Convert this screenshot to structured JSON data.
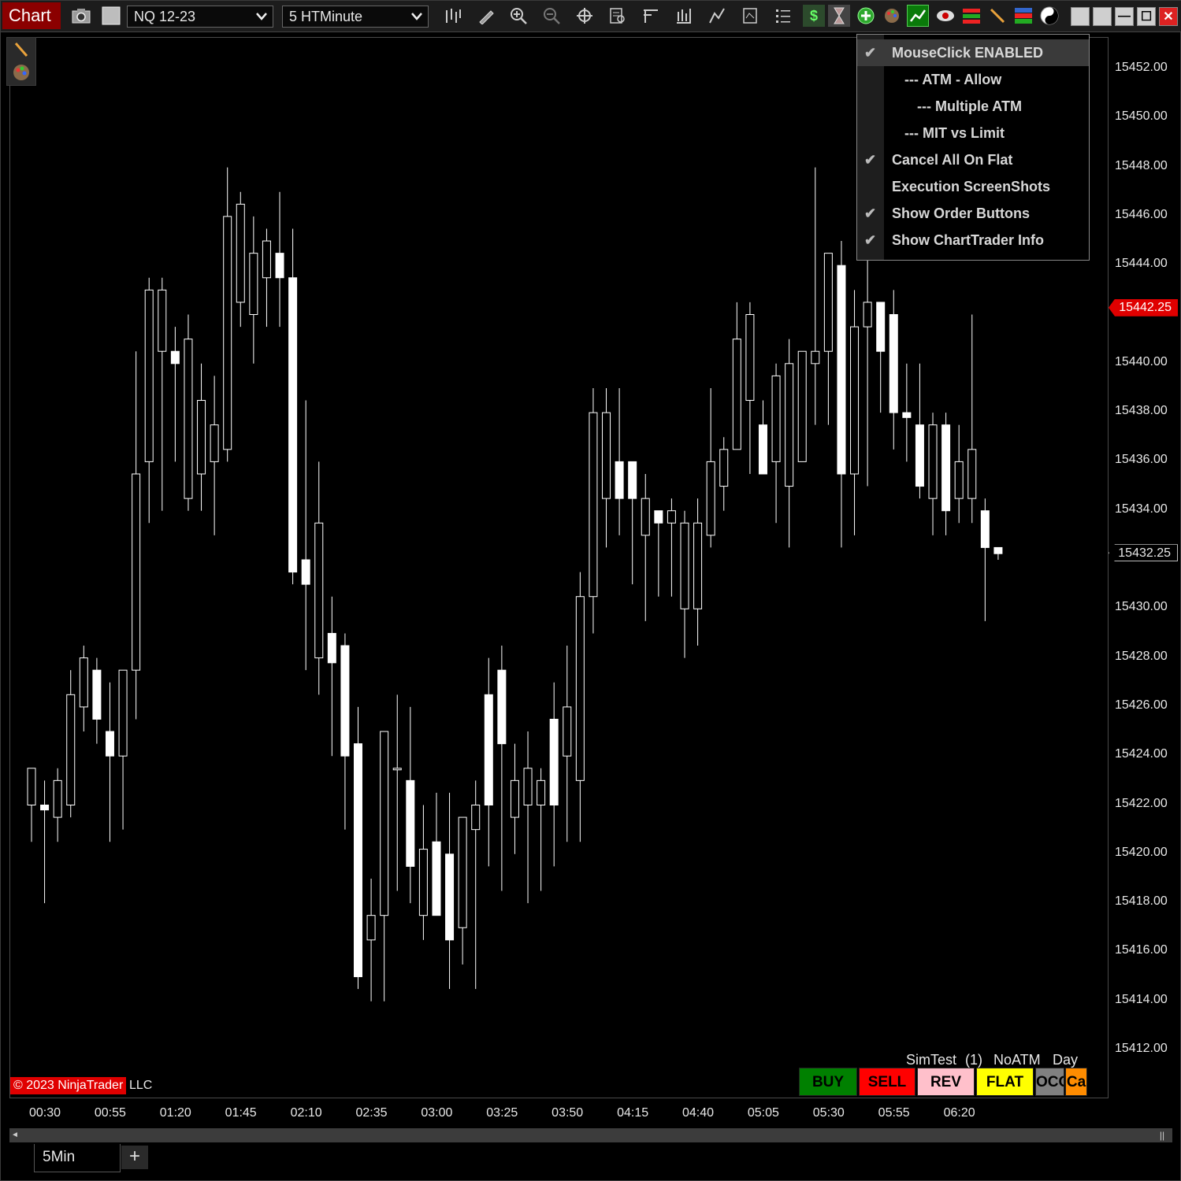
{
  "toolbar": {
    "title": "Chart",
    "instrument": "NQ 12-23",
    "interval": "5 HTMinute",
    "icons": [
      "camera-icon",
      "properties-icon",
      "bar-type-icon",
      "draw-icon",
      "zoom-in-icon",
      "zoom-out-icon",
      "crosshair-icon",
      "data-box-icon",
      "indicators-icon",
      "strategies-icon",
      "drawing-tools-icon",
      "templates-icon",
      "instrument-list-icon",
      "dollar-icon",
      "hourglass-icon",
      "add-icon",
      "palette-icon",
      "green-chart-icon",
      "eye-icon",
      "bars-color-icon",
      "pencil-icon",
      "flag-icon",
      "yin-yang-icon"
    ],
    "window_buttons": {
      "restore": "",
      "restore2": "",
      "minimize": "—",
      "maximize": "☐",
      "close": "✕"
    }
  },
  "menu": {
    "items": [
      {
        "label": "MouseClick ENABLED",
        "checked": true,
        "indent": 0
      },
      {
        "label": "--- ATM - Allow",
        "checked": false,
        "indent": 1
      },
      {
        "label": "--- Multiple ATM",
        "checked": false,
        "indent": 2
      },
      {
        "label": "--- MIT vs Limit",
        "checked": false,
        "indent": 1
      },
      {
        "label": "Cancel All On Flat",
        "checked": true,
        "indent": 0
      },
      {
        "label": "Execution ScreenShots",
        "checked": false,
        "indent": 0
      },
      {
        "label": "Show Order Buttons",
        "checked": true,
        "indent": 0
      },
      {
        "label": "Show ChartTrader Info",
        "checked": true,
        "indent": 0
      }
    ],
    "check_glyph": "✔"
  },
  "y_axis": {
    "ticks": [
      "15452.00",
      "15450.00",
      "15448.00",
      "15446.00",
      "15444.00",
      "15440.00",
      "15438.00",
      "15436.00",
      "15434.00",
      "15430.00",
      "15428.00",
      "15426.00",
      "15424.00",
      "15422.00",
      "15420.00",
      "15418.00",
      "15416.00",
      "15414.00",
      "15412.00"
    ],
    "last_price": "15442.25",
    "current_price": "15432.25"
  },
  "x_axis": {
    "ticks": [
      "00:30",
      "00:55",
      "01:20",
      "01:45",
      "02:10",
      "02:35",
      "03:00",
      "03:25",
      "03:50",
      "04:15",
      "04:40",
      "05:05",
      "05:30",
      "05:55",
      "06:20"
    ]
  },
  "copyright": {
    "text": "© 2023 NinjaTrader",
    "suffix": "LLC"
  },
  "trader_info": {
    "account": "SimTest",
    "qty": "(1)",
    "atm": "NoATM",
    "tif": "Day"
  },
  "order_buttons": [
    {
      "label": "BUY",
      "color": "#008000",
      "text": "#000000"
    },
    {
      "label": "SELL",
      "color": "#ff0000",
      "text": "#000000"
    },
    {
      "label": "REV",
      "color": "#ffc0cb",
      "text": "#000000"
    },
    {
      "label": "FLAT",
      "color": "#ffff00",
      "text": "#000000"
    },
    {
      "label": "OCO",
      "color": "#808080",
      "text": "#000000"
    },
    {
      "label": "Ca",
      "color": "#ff8c00",
      "text": "#000000"
    }
  ],
  "tabs": {
    "active": "5Min",
    "add": "+"
  },
  "scrollbar": {
    "left_glyph": "◄",
    "right_glyph": "||"
  },
  "colors": {
    "background": "#000000",
    "candle": "#ffffff",
    "last_price": "#e00000",
    "title_bg": "#8b0000"
  },
  "chart_data": {
    "type": "candlestick",
    "instrument": "NQ 12-23",
    "interval": "5 HTMinute",
    "ylim": [
      15410.5,
      15453.5
    ],
    "candles": [
      {
        "o": 15422.0,
        "h": 15423.5,
        "l": 15420.5,
        "c": 15423.5
      },
      {
        "o": 15422.0,
        "h": 15423.0,
        "l": 15418.0,
        "c": 15421.8
      },
      {
        "o": 15421.5,
        "h": 15423.5,
        "l": 15420.5,
        "c": 15423.0
      },
      {
        "o": 15422.0,
        "h": 15427.5,
        "l": 15421.5,
        "c": 15426.5
      },
      {
        "o": 15426.0,
        "h": 15428.5,
        "l": 15425.0,
        "c": 15428.0
      },
      {
        "o": 15427.5,
        "h": 15428.0,
        "l": 15424.5,
        "c": 15425.5
      },
      {
        "o": 15425.0,
        "h": 15427.0,
        "l": 15420.5,
        "c": 15424.0
      },
      {
        "o": 15424.0,
        "h": 15427.5,
        "l": 15421.0,
        "c": 15427.5
      },
      {
        "o": 15427.5,
        "h": 15440.5,
        "l": 15425.5,
        "c": 15435.5
      },
      {
        "o": 15436.0,
        "h": 15443.5,
        "l": 15433.5,
        "c": 15443.0
      },
      {
        "o": 15440.5,
        "h": 15443.5,
        "l": 15434.0,
        "c": 15443.0
      },
      {
        "o": 15440.5,
        "h": 15441.5,
        "l": 15436.0,
        "c": 15440.0
      },
      {
        "o": 15434.5,
        "h": 15442.0,
        "l": 15434.0,
        "c": 15441.0
      },
      {
        "o": 15435.5,
        "h": 15440.0,
        "l": 15434.0,
        "c": 15438.5
      },
      {
        "o": 15436.0,
        "h": 15439.5,
        "l": 15433.0,
        "c": 15437.5
      },
      {
        "o": 15436.5,
        "h": 15448.0,
        "l": 15436.0,
        "c": 15446.0
      },
      {
        "o": 15442.5,
        "h": 15447.0,
        "l": 15441.5,
        "c": 15446.5
      },
      {
        "o": 15442.0,
        "h": 15446.0,
        "l": 15440.0,
        "c": 15444.5
      },
      {
        "o": 15443.5,
        "h": 15445.5,
        "l": 15441.5,
        "c": 15445.0
      },
      {
        "o": 15444.5,
        "h": 15447.0,
        "l": 15441.5,
        "c": 15443.5
      },
      {
        "o": 15443.5,
        "h": 15445.5,
        "l": 15431.0,
        "c": 15431.5
      },
      {
        "o": 15432.0,
        "h": 15438.5,
        "l": 15427.5,
        "c": 15431.0
      },
      {
        "o": 15428.0,
        "h": 15436.0,
        "l": 15426.5,
        "c": 15433.5
      },
      {
        "o": 15429.0,
        "h": 15430.5,
        "l": 15424.0,
        "c": 15427.8
      },
      {
        "o": 15428.5,
        "h": 15429.0,
        "l": 15421.0,
        "c": 15424.0
      },
      {
        "o": 15424.5,
        "h": 15426.0,
        "l": 15414.5,
        "c": 15415.0
      },
      {
        "o": 15416.5,
        "h": 15419.0,
        "l": 15414.0,
        "c": 15417.5
      },
      {
        "o": 15417.5,
        "h": 15424.5,
        "l": 15414.0,
        "c": 15425.0
      },
      {
        "o": 15423.5,
        "h": 15426.5,
        "l": 15418.5,
        "c": 15423.5
      },
      {
        "o": 15423.0,
        "h": 15426.0,
        "l": 15418.0,
        "c": 15419.5
      },
      {
        "o": 15417.5,
        "h": 15422.0,
        "l": 15416.5,
        "c": 15420.2
      },
      {
        "o": 15420.5,
        "h": 15422.5,
        "l": 15417.5,
        "c": 15417.5
      },
      {
        "o": 15420.0,
        "h": 15422.5,
        "l": 15414.5,
        "c": 15416.5
      },
      {
        "o": 15417.0,
        "h": 15421.0,
        "l": 15415.5,
        "c": 15421.5
      },
      {
        "o": 15421.0,
        "h": 15423.0,
        "l": 15414.5,
        "c": 15422.0
      },
      {
        "o": 15426.5,
        "h": 15428.0,
        "l": 15419.5,
        "c": 15422.0
      },
      {
        "o": 15427.5,
        "h": 15428.5,
        "l": 15418.5,
        "c": 15424.5
      },
      {
        "o": 15421.5,
        "h": 15424.5,
        "l": 15420.0,
        "c": 15423.0
      },
      {
        "o": 15422.0,
        "h": 15425.0,
        "l": 15418.0,
        "c": 15423.5
      },
      {
        "o": 15422.0,
        "h": 15423.5,
        "l": 15418.5,
        "c": 15423.0
      },
      {
        "o": 15425.5,
        "h": 15427.0,
        "l": 15419.5,
        "c": 15422.0
      },
      {
        "o": 15424.0,
        "h": 15428.5,
        "l": 15420.5,
        "c": 15426.0
      },
      {
        "o": 15423.0,
        "h": 15431.5,
        "l": 15420.5,
        "c": 15430.5
      },
      {
        "o": 15430.5,
        "h": 15439.0,
        "l": 15429.0,
        "c": 15438.0
      },
      {
        "o": 15434.5,
        "h": 15439.0,
        "l": 15432.5,
        "c": 15438.0
      },
      {
        "o": 15436.0,
        "h": 15439.0,
        "l": 15433.0,
        "c": 15434.5
      },
      {
        "o": 15436.0,
        "h": 15436.0,
        "l": 15431.0,
        "c": 15434.5
      },
      {
        "o": 15433.0,
        "h": 15435.5,
        "l": 15429.5,
        "c": 15434.5
      },
      {
        "o": 15434.0,
        "h": 15433.5,
        "l": 15430.5,
        "c": 15433.5
      },
      {
        "o": 15433.5,
        "h": 15434.5,
        "l": 15430.5,
        "c": 15434.0
      },
      {
        "o": 15430.0,
        "h": 15434.0,
        "l": 15428.0,
        "c": 15433.5
      },
      {
        "o": 15430.0,
        "h": 15434.5,
        "l": 15428.5,
        "c": 15433.5
      },
      {
        "o": 15433.0,
        "h": 15439.0,
        "l": 15432.5,
        "c": 15436.0
      },
      {
        "o": 15435.0,
        "h": 15437.0,
        "l": 15434.0,
        "c": 15436.5
      },
      {
        "o": 15436.5,
        "h": 15442.5,
        "l": 15436.5,
        "c": 15441.0
      },
      {
        "o": 15438.5,
        "h": 15442.5,
        "l": 15435.5,
        "c": 15442.0
      },
      {
        "o": 15437.5,
        "h": 15438.5,
        "l": 15435.5,
        "c": 15435.5
      },
      {
        "o": 15436.0,
        "h": 15440.0,
        "l": 15433.5,
        "c": 15439.5
      },
      {
        "o": 15435.0,
        "h": 15441.0,
        "l": 15432.5,
        "c": 15440.0
      },
      {
        "o": 15436.0,
        "h": 15440.5,
        "l": 15436.5,
        "c": 15440.5
      },
      {
        "o": 15440.0,
        "h": 15448.0,
        "l": 15437.5,
        "c": 15440.5
      },
      {
        "o": 15440.5,
        "h": 15444.5,
        "l": 15437.5,
        "c": 15444.5
      },
      {
        "o": 15444.0,
        "h": 15445.0,
        "l": 15432.5,
        "c": 15435.5
      },
      {
        "o": 15435.5,
        "h": 15443.0,
        "l": 15433.0,
        "c": 15441.5
      },
      {
        "o": 15441.5,
        "h": 15447.0,
        "l": 15435.0,
        "c": 15442.5
      },
      {
        "o": 15442.5,
        "h": 15442.5,
        "l": 15438.0,
        "c": 15440.5
      },
      {
        "o": 15442.0,
        "h": 15443.0,
        "l": 15436.5,
        "c": 15438.0
      },
      {
        "o": 15438.0,
        "h": 15440.0,
        "l": 15436.0,
        "c": 15437.8
      },
      {
        "o": 15437.5,
        "h": 15440.0,
        "l": 15434.5,
        "c": 15435.0
      },
      {
        "o": 15434.5,
        "h": 15438.0,
        "l": 15433.0,
        "c": 15437.5
      },
      {
        "o": 15437.5,
        "h": 15438.0,
        "l": 15433.0,
        "c": 15434.0
      },
      {
        "o": 15434.5,
        "h": 15437.5,
        "l": 15433.5,
        "c": 15436.0
      },
      {
        "o": 15434.5,
        "h": 15442.0,
        "l": 15433.5,
        "c": 15436.5
      },
      {
        "o": 15434.0,
        "h": 15434.5,
        "l": 15429.5,
        "c": 15432.5
      },
      {
        "o": 15432.5,
        "h": 15432.5,
        "l": 15432.0,
        "c": 15432.25
      }
    ]
  }
}
